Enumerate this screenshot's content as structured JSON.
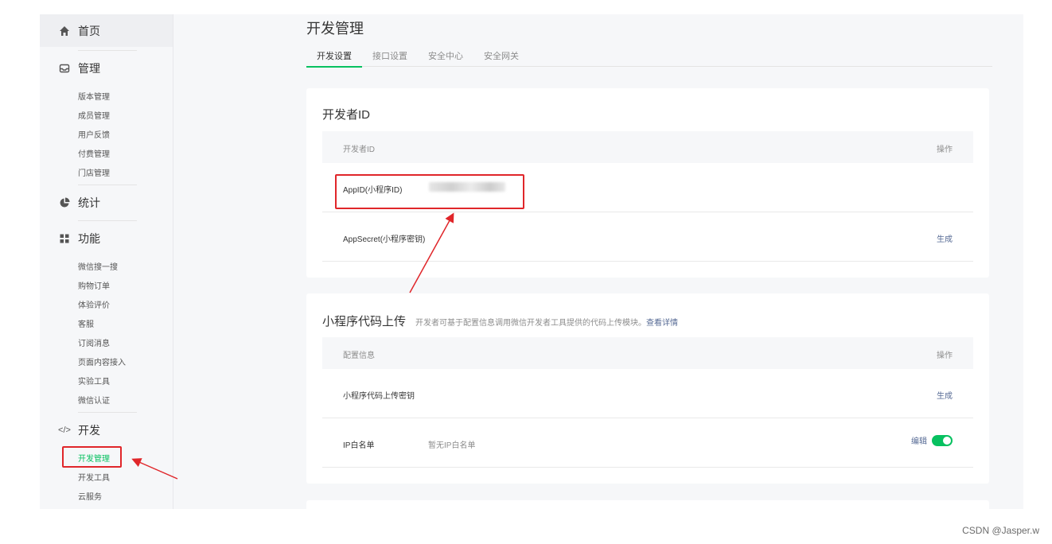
{
  "sidebar": {
    "home": "首页",
    "sections": [
      {
        "title": "管理",
        "items": [
          "版本管理",
          "成员管理",
          "用户反馈",
          "付费管理",
          "门店管理"
        ]
      },
      {
        "title": "统计",
        "items": []
      },
      {
        "title": "功能",
        "items": [
          "微信搜一搜",
          "购物订单",
          "体验评价",
          "客服",
          "订阅消息",
          "页面内容接入",
          "实验工具",
          "微信认证"
        ]
      },
      {
        "title": "开发",
        "items": [
          "开发管理",
          "开发工具",
          "云服务"
        ]
      }
    ],
    "active_item": "开发管理",
    "icons": [
      "home-icon",
      "inbox-icon",
      "pie-chart-icon",
      "grid-icon",
      "code-icon"
    ]
  },
  "main": {
    "title": "开发管理",
    "tabs": [
      "开发设置",
      "接口设置",
      "安全中心",
      "安全网关"
    ],
    "active_tab": "开发设置",
    "developer_id": {
      "title": "开发者ID",
      "header_left": "开发者ID",
      "header_right": "操作",
      "rows": [
        {
          "label": "AppID(小程序ID)",
          "value": "",
          "action": ""
        },
        {
          "label": "AppSecret(小程序密钥)",
          "value": "",
          "action": "生成"
        }
      ]
    },
    "code_upload": {
      "title": "小程序代码上传",
      "desc": "开发者可基于配置信息调用微信开发者工具提供的代码上传模块。",
      "desc_link": "查看详情",
      "header_left": "配置信息",
      "header_right": "操作",
      "rows": [
        {
          "label": "小程序代码上传密钥",
          "value": "",
          "action": "生成"
        },
        {
          "label": "IP白名单",
          "value": "暂无IP白名单",
          "action": "编辑"
        }
      ]
    }
  },
  "watermark": "CSDN @Jasper.w",
  "colors": {
    "accent": "#07c160",
    "link": "#576b95",
    "annotation": "#e0262a"
  }
}
